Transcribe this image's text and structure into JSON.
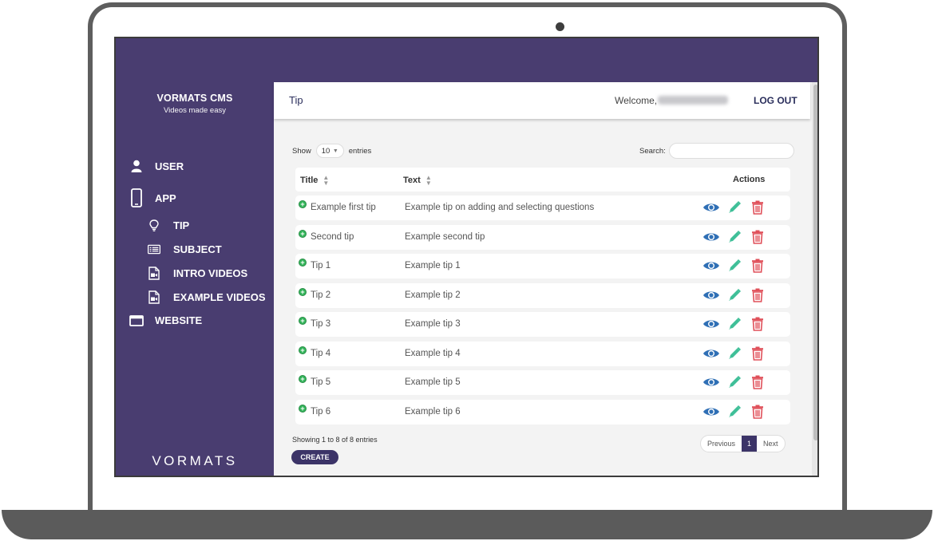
{
  "app": {
    "brand_name": "VORMATS CMS",
    "brand_tagline": "Videos made easy",
    "logo_word": "VORMATS"
  },
  "sidebar": {
    "items": [
      {
        "label": "USER",
        "icon": "user-icon"
      },
      {
        "label": "APP",
        "icon": "mobile-icon"
      },
      {
        "label": "TIP",
        "icon": "lightbulb-icon"
      },
      {
        "label": "SUBJECT",
        "icon": "list-icon"
      },
      {
        "label": "INTRO VIDEOS",
        "icon": "video-file-icon"
      },
      {
        "label": "EXAMPLE VIDEOS",
        "icon": "video-file-icon"
      },
      {
        "label": "WEBSITE",
        "icon": "window-icon"
      }
    ]
  },
  "header": {
    "title": "Tip",
    "welcome": "Welcome,",
    "logout": "LOG OUT"
  },
  "table_controls": {
    "show_label": "Show",
    "page_length": "10",
    "entries_label": "entries",
    "search_label": "Search:",
    "search_value": ""
  },
  "table": {
    "columns": [
      "Title",
      "Text",
      "Actions"
    ],
    "rows": [
      {
        "title": "Example first tip",
        "text": "Example tip on adding and selecting questions"
      },
      {
        "title": "Second tip",
        "text": "Example second tip"
      },
      {
        "title": "Tip 1",
        "text": "Example tip 1"
      },
      {
        "title": "Tip 2",
        "text": "Example tip 2"
      },
      {
        "title": "Tip 3",
        "text": "Example tip 3"
      },
      {
        "title": "Tip 4",
        "text": "Example tip 4"
      },
      {
        "title": "Tip 5",
        "text": "Example tip 5"
      },
      {
        "title": "Tip 6",
        "text": "Example tip 6"
      }
    ]
  },
  "footer": {
    "info": "Showing 1 to 8 of 8 entries",
    "create": "CREATE",
    "pager": {
      "previous": "Previous",
      "current": "1",
      "next": "Next"
    }
  },
  "colors": {
    "brand": "#493d70",
    "view": "#2f6fb5",
    "edit": "#3fbf98",
    "delete": "#e0505a",
    "add": "#33b45a"
  }
}
